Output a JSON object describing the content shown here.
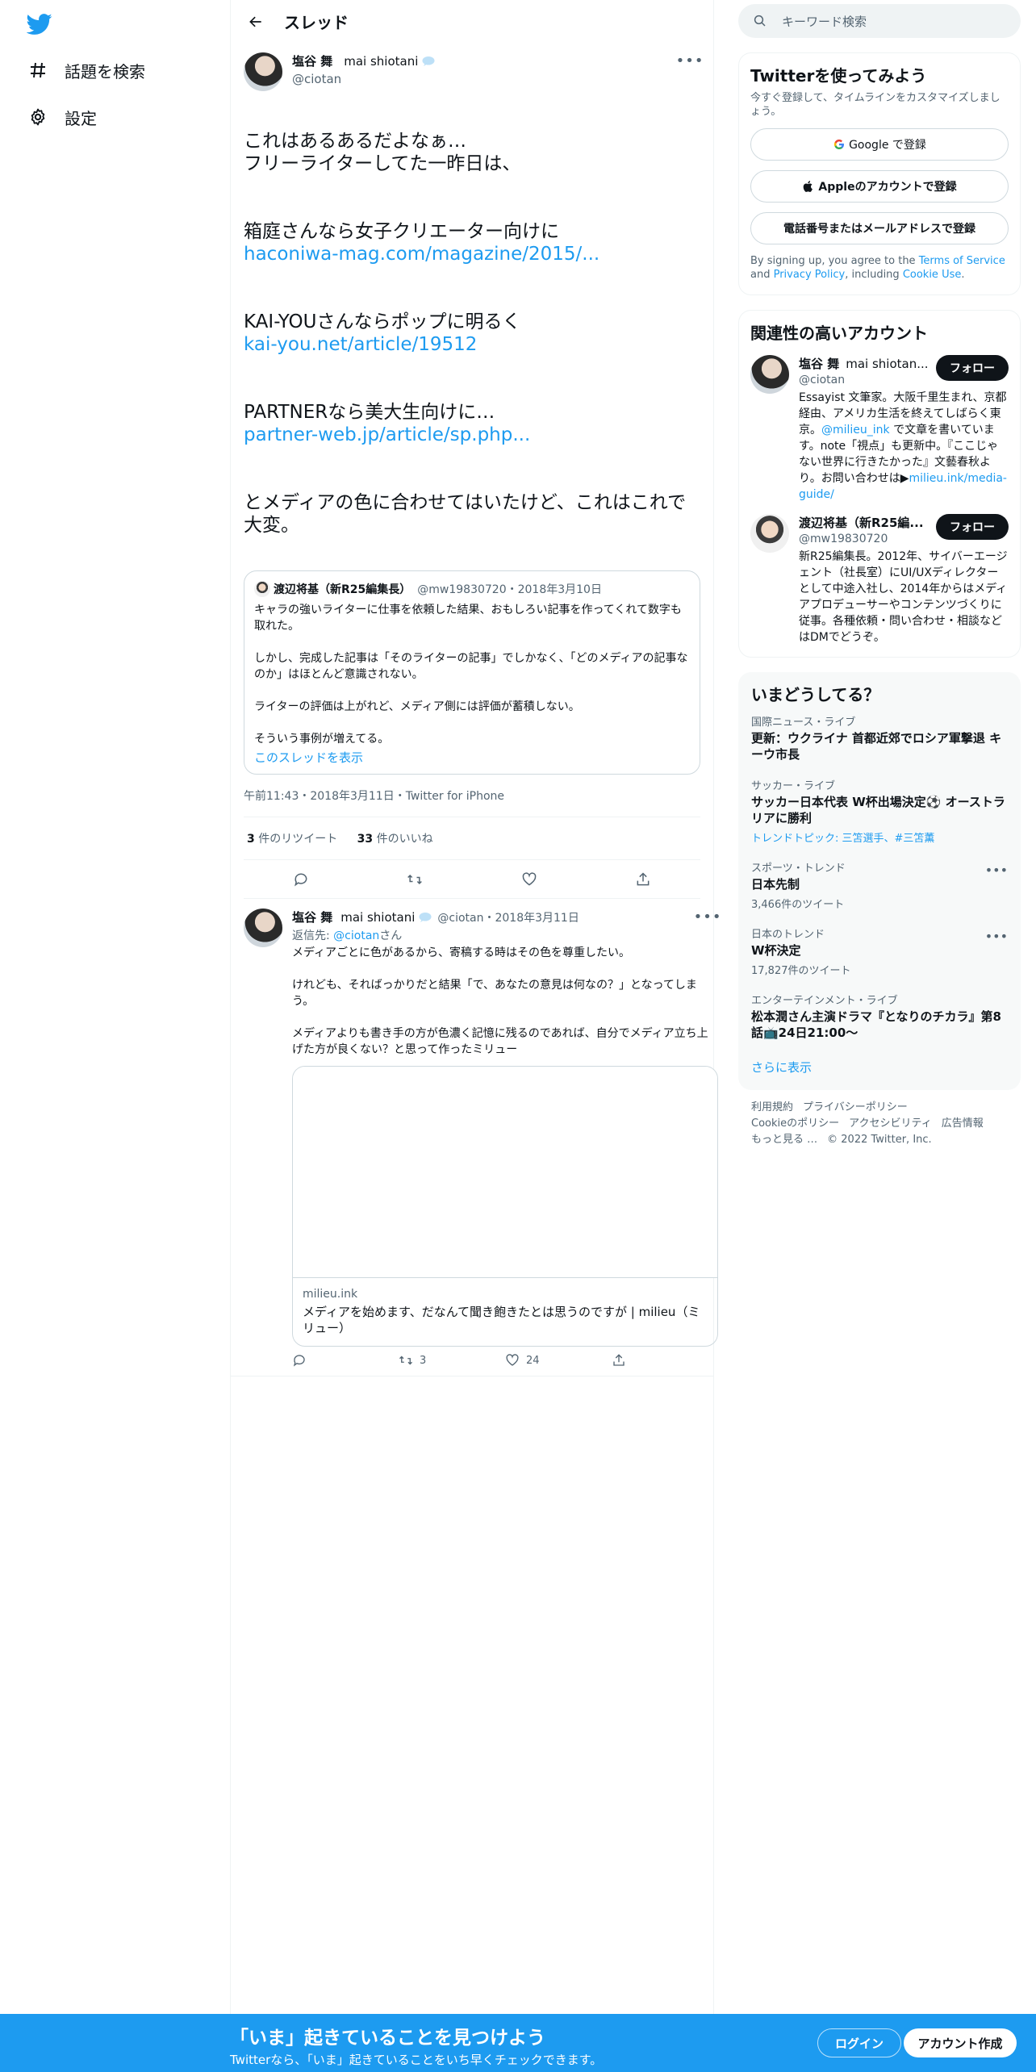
{
  "nav": {
    "items": [
      {
        "label": "話題を検索",
        "icon": "hashtag-icon"
      },
      {
        "label": "設定",
        "icon": "gear-icon"
      }
    ]
  },
  "header": {
    "title": "スレッド"
  },
  "tweet": {
    "author_name": "塩谷 舞",
    "author_sub": "mai shiotani",
    "handle": "@ciotan",
    "paragraphs": [
      {
        "text": "これはあるあるだよなぁ…\nフリーライターしてた一昨日は、",
        "link": ""
      },
      {
        "text": "箱庭さんなら女子クリエーター向けに",
        "link": "haconiwa-mag.com/magazine/2015/..."
      },
      {
        "text": "KAI-YOUさんならポップに明るく",
        "link": "kai-you.net/article/19512"
      },
      {
        "text": "PARTNERなら美大生向けに…",
        "link": "partner-web.jp/article/sp.php..."
      },
      {
        "text": "とメディアの色に合わせてはいたけど、これはこれで大変。",
        "link": ""
      }
    ],
    "quote": {
      "name": "渡辺将基（新R25編集長）",
      "handle": "@mw19830720・2018年3月10日",
      "paragraphs": [
        "キャラの強いライターに仕事を依頼した結果、おもしろい記事を作ってくれて数字も取れた。",
        "しかし、完成した記事は「そのライターの記事」でしかなく、「どのメディアの記事なのか」はほとんど意識されない。",
        "ライターの評価は上がれど、メディア側には評価が蓄積しない。",
        "そういう事例が増えてる。"
      ],
      "show_thread": "このスレッドを表示"
    },
    "meta": "午前11:43・2018年3月11日・Twitter for iPhone",
    "retweets": "3",
    "retweets_label": " 件のリツイート",
    "likes": "33",
    "likes_label": " 件のいいね"
  },
  "reply": {
    "author_name": "塩谷 舞",
    "author_sub": "mai shiotani",
    "handle_date": "@ciotan・2018年3月11日",
    "reply_to_prefix": "返信先: ",
    "reply_to_handle": "@ciotan",
    "reply_to_suffix": "さん",
    "paragraphs": [
      "メディアごとに色があるから、寄稿する時はその色を尊重したい。",
      "けれども、そればっかりだと結果「で、あなたの意見は何なの？」となってしまう。",
      "メディアよりも書き手の方が色濃く記憶に残るのであれば、自分でメディア立ち上げた方が良くない？と思って作ったミリュー"
    ],
    "card_domain": "milieu.ink",
    "card_title": "メディアを始めます、だなんて聞き飽きたとは思うのですが | milieu（ミリュー）",
    "retweets": "3",
    "likes": "24"
  },
  "right": {
    "search_placeholder": "キーワード検索",
    "signup": {
      "title": "Twitterを使ってみよう",
      "subtitle": "今すぐ登録して、タイムラインをカスタマイズしましょう。",
      "google": "Google で登録",
      "apple": "Appleのアカウントで登録",
      "phone": "電話番号またはメールアドレスで登録",
      "terms_1": "By signing up, you agree to the ",
      "terms_link1": "Terms of Service",
      "terms_2": " and ",
      "terms_link2": "Privacy Policy",
      "terms_3": ", including ",
      "terms_link3": "Cookie Use",
      "terms_4": "."
    },
    "related": {
      "title": "関連性の高いアカウント",
      "follow_label": "フォロー",
      "accounts": [
        {
          "name": "塩谷 舞",
          "sub": "mai shiotan...",
          "handle": "@ciotan",
          "bio_1": "Essayist 文筆家。大阪千里生まれ、京都経由、アメリカ生活を終えてしばらく東京。",
          "bio_link1": "@milieu_ink",
          "bio_2": " で文章を書いています。note「視点」も更新中。『ここじゃない世界に行きたかった』文藝春秋より。お問い合わせは▶",
          "bio_link2": "milieu.ink/media-guide/"
        },
        {
          "name": "渡辺将基（新R25編...",
          "sub": "",
          "handle": "@mw19830720",
          "bio_1": "新R25編集長。2012年、サイバーエージェント（社長室）にUI/UXディレクターとして中途入社し、2014年からはメディアプロデューサーやコンテンツづくりに従事。各種依頼・問い合わせ・相談などはDMでどうぞ。",
          "bio_link1": "",
          "bio_2": "",
          "bio_link2": ""
        }
      ]
    },
    "trends": {
      "title": "いまどうしてる？",
      "items": [
        {
          "ctx": "国際ニュース・ライブ",
          "title": "更新：ウクライナ 首都近郊でロシア軍撃退 キーウ市長",
          "meta": "",
          "more": false
        },
        {
          "ctx": "サッカー・ライブ",
          "title": "サッカー日本代表 W杯出場決定⚽️ オーストラリアに勝利",
          "meta": "トレンドトピック: 三笘選手、#三笘薫",
          "more": false
        },
        {
          "ctx": "スポーツ・トレンド",
          "title": "日本先制",
          "meta": "3,466件のツイート",
          "more": true
        },
        {
          "ctx": "日本のトレンド",
          "title": "W杯決定",
          "meta": "17,827件のツイート",
          "more": true
        },
        {
          "ctx": "エンターテインメント・ライブ",
          "title": "松本潤さん主演ドラマ『となりのチカラ』第8話📺24日21:00〜",
          "meta": "",
          "more": false
        }
      ],
      "show_more": "さらに表示"
    },
    "footer": {
      "line1": [
        "利用規約",
        "プライバシーポリシー"
      ],
      "line2": [
        "Cookieのポリシー",
        "アクセシビリティ",
        "広告情報"
      ],
      "line3": [
        "もっと見る …",
        "© 2022 Twitter, Inc."
      ]
    }
  },
  "bottom_bar": {
    "title": "「いま」起きていることを見つけよう",
    "subtitle": "Twitterなら、「いま」起きていることをいち早くチェックできます。",
    "login": "ログイン",
    "signup": "アカウント作成"
  },
  "colors": {
    "accent": "#1d9bf0",
    "text": "#0f1419",
    "muted": "#536471"
  }
}
